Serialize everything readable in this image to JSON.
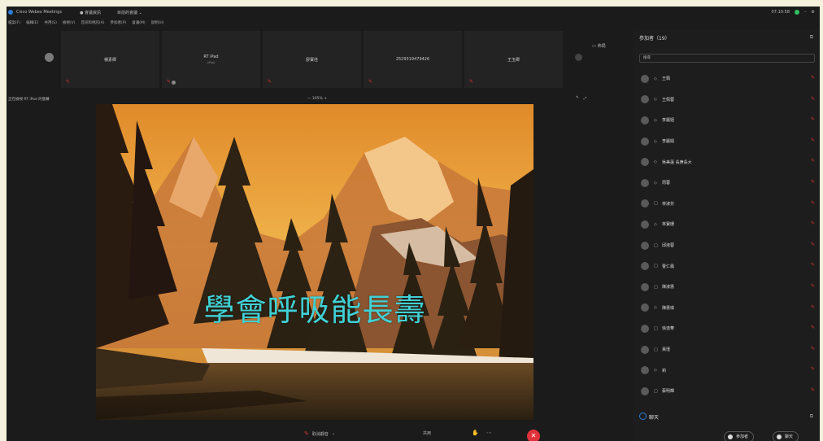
{
  "titlebar": {
    "title": "Cisco Webex Meetings",
    "meta": "● 會議資訊",
    "tab": "目前的會議  ⌄",
    "time": "07:10:58"
  },
  "menu": [
    "檔案(F)",
    "編輯(E)",
    "共用(S)",
    "檢視(V)",
    "音訊和視訊(A)",
    "參加者(P)",
    "會議(M)",
    "說明(H)"
  ],
  "thumbnails": [
    {
      "name": "楊素卿",
      "sub": ""
    },
    {
      "name": "RT iPad",
      "sub": "(iPad)"
    },
    {
      "name": "廖寶佳",
      "sub": ""
    },
    {
      "name": "2529319479426",
      "sub": ""
    },
    {
      "name": "王玉卿",
      "sub": ""
    }
  ],
  "layout_label": "佈局",
  "share_bar": {
    "label": "正在檢視 RT iPad 的螢幕",
    "zoom": "— 105%  +"
  },
  "slide": {
    "caption": "學會呼吸能長壽"
  },
  "panel": {
    "title": "参加者（19）",
    "search_placeholder": "搜尋",
    "participants": [
      {
        "status": "◇",
        "name": "王珮"
      },
      {
        "status": "◇",
        "name": "王佩蓉"
      },
      {
        "status": "◇",
        "name": "李麗姐"
      },
      {
        "status": "◇",
        "name": "李麗娟"
      },
      {
        "status": "◇",
        "name": "吳美蓮 長庚長大"
      },
      {
        "status": "◇",
        "name": "周蓉"
      },
      {
        "status": "□",
        "name": "林淑芬"
      },
      {
        "status": "◇",
        "name": "林寶珊"
      },
      {
        "status": "□",
        "name": "邱淑蓉"
      },
      {
        "status": "□",
        "name": "曹仁鳳"
      },
      {
        "status": "□",
        "name": "陳淑惠"
      },
      {
        "status": "◇",
        "name": "陳惠琪"
      },
      {
        "status": "□",
        "name": "徐逸華"
      },
      {
        "status": "□",
        "name": "黃瑾"
      },
      {
        "status": "◇",
        "name": "莉"
      },
      {
        "status": "□",
        "name": "蔡明輝"
      }
    ],
    "chat_label": "聊天",
    "participants_button": "參加者",
    "chat_button": "聊天"
  },
  "bottombar": {
    "mute_label": "取消靜音",
    "share_label": "共用"
  }
}
